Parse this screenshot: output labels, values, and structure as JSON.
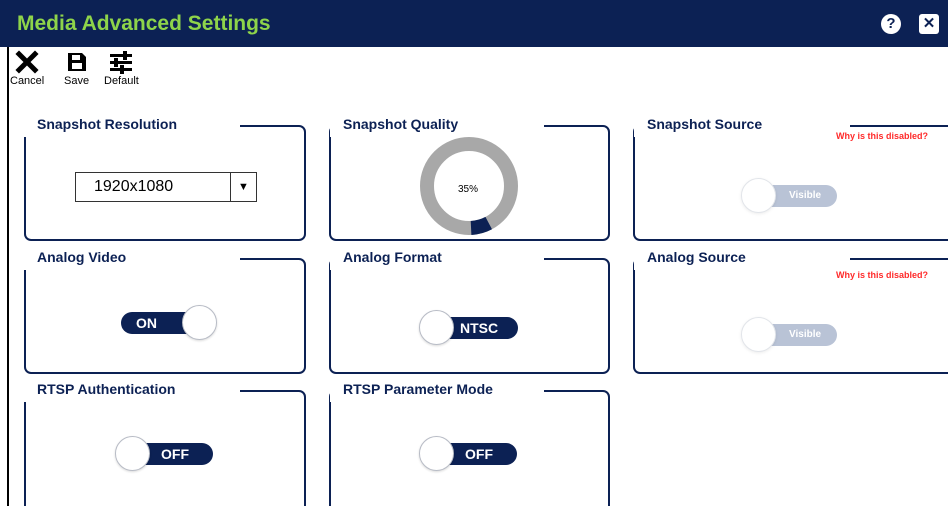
{
  "window": {
    "title": "Media Advanced Settings",
    "help_icon": "?",
    "close_icon": "✕"
  },
  "toolbar": {
    "cancel_label": "Cancel",
    "save_label": "Save",
    "default_label": "Default"
  },
  "cards": {
    "snapshot_resolution": {
      "title": "Snapshot Resolution",
      "selected": "1920x1080",
      "arrow": "▼"
    },
    "snapshot_quality": {
      "title": "Snapshot Quality",
      "percent_label": "35%",
      "value_fraction": 0.07
    },
    "snapshot_source": {
      "title": "Snapshot Source",
      "disabled_link": "Why is this disabled?",
      "toggle_label": "Visible",
      "state": "on",
      "enabled": false
    },
    "analog_video": {
      "title": "Analog Video",
      "toggle_label": "ON",
      "state": "on"
    },
    "analog_format": {
      "title": "Analog Format",
      "toggle_label": "NTSC",
      "state": "off"
    },
    "analog_source": {
      "title": "Analog Source",
      "disabled_link": "Why is this disabled?",
      "toggle_label": "Visible",
      "state": "on",
      "enabled": false
    },
    "rtsp_authentication": {
      "title": "RTSP Authentication",
      "toggle_label": "OFF",
      "state": "off"
    },
    "rtsp_parameter_mode": {
      "title": "RTSP Parameter Mode",
      "toggle_label": "OFF",
      "state": "off"
    }
  },
  "colors": {
    "titlebar_bg": "#0c2154",
    "title_text": "#8ed44a",
    "accent_navy": "#0c2154",
    "disabled_toggle": "#b9c3d6",
    "warning_text": "#ff2a2a",
    "gauge_track": "#a8a8a8"
  }
}
